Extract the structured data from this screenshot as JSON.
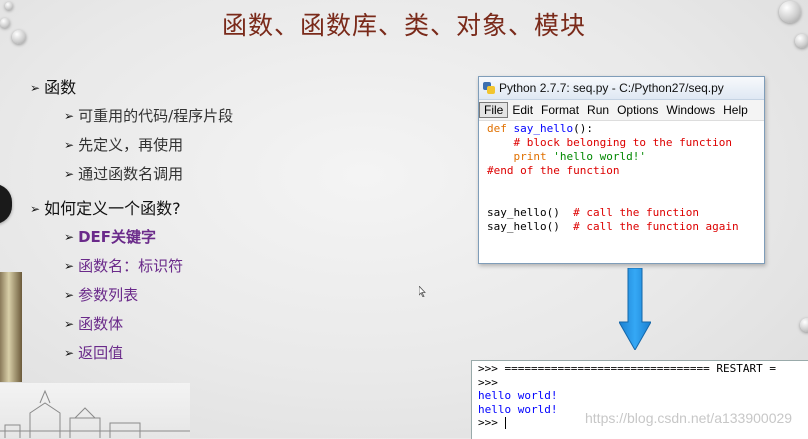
{
  "slide": {
    "title": "函数、函数库、类、对象、模块",
    "bullets": [
      {
        "label": "函数",
        "children": [
          "可重用的代码/程序片段",
          "先定义，再使用",
          "通过函数名调用"
        ]
      },
      {
        "label": "如何定义一个函数?",
        "children": [
          "DEF关键字",
          "函数名：标识符",
          "参数列表",
          "函数体",
          "返回值"
        ]
      }
    ]
  },
  "editor": {
    "title": "Python 2.7.7: seq.py - C:/Python27/seq.py",
    "menus": [
      "File",
      "Edit",
      "Format",
      "Run",
      "Options",
      "Windows",
      "Help"
    ],
    "code": {
      "kw_def": "def",
      "fn_name": "say_hello",
      "sig_rest": "():",
      "comment1": "# block belonging to the function",
      "kw_print": "print",
      "print_str": "'hello world!'",
      "end_comment": "#end of the function",
      "call1": "say_hello()",
      "call1_comment": "# call the function",
      "call2": "say_hello()",
      "call2_comment": "# call the function again"
    }
  },
  "shell": {
    "restart_line": ">>> =============================== RESTART =",
    "prompt1": ">>>",
    "out1": "hello world!",
    "out2": "hello world!",
    "prompt2": ">>>"
  },
  "watermark": "https://blog.csdn.net/a133900029",
  "colors": {
    "title": "#7a2a1a",
    "purple_item": "#6a2a8a",
    "keyword": "#e07000",
    "function": "#0000ff",
    "comment": "#dd0000",
    "string": "#008800",
    "arrow": "#1b8fe3"
  }
}
